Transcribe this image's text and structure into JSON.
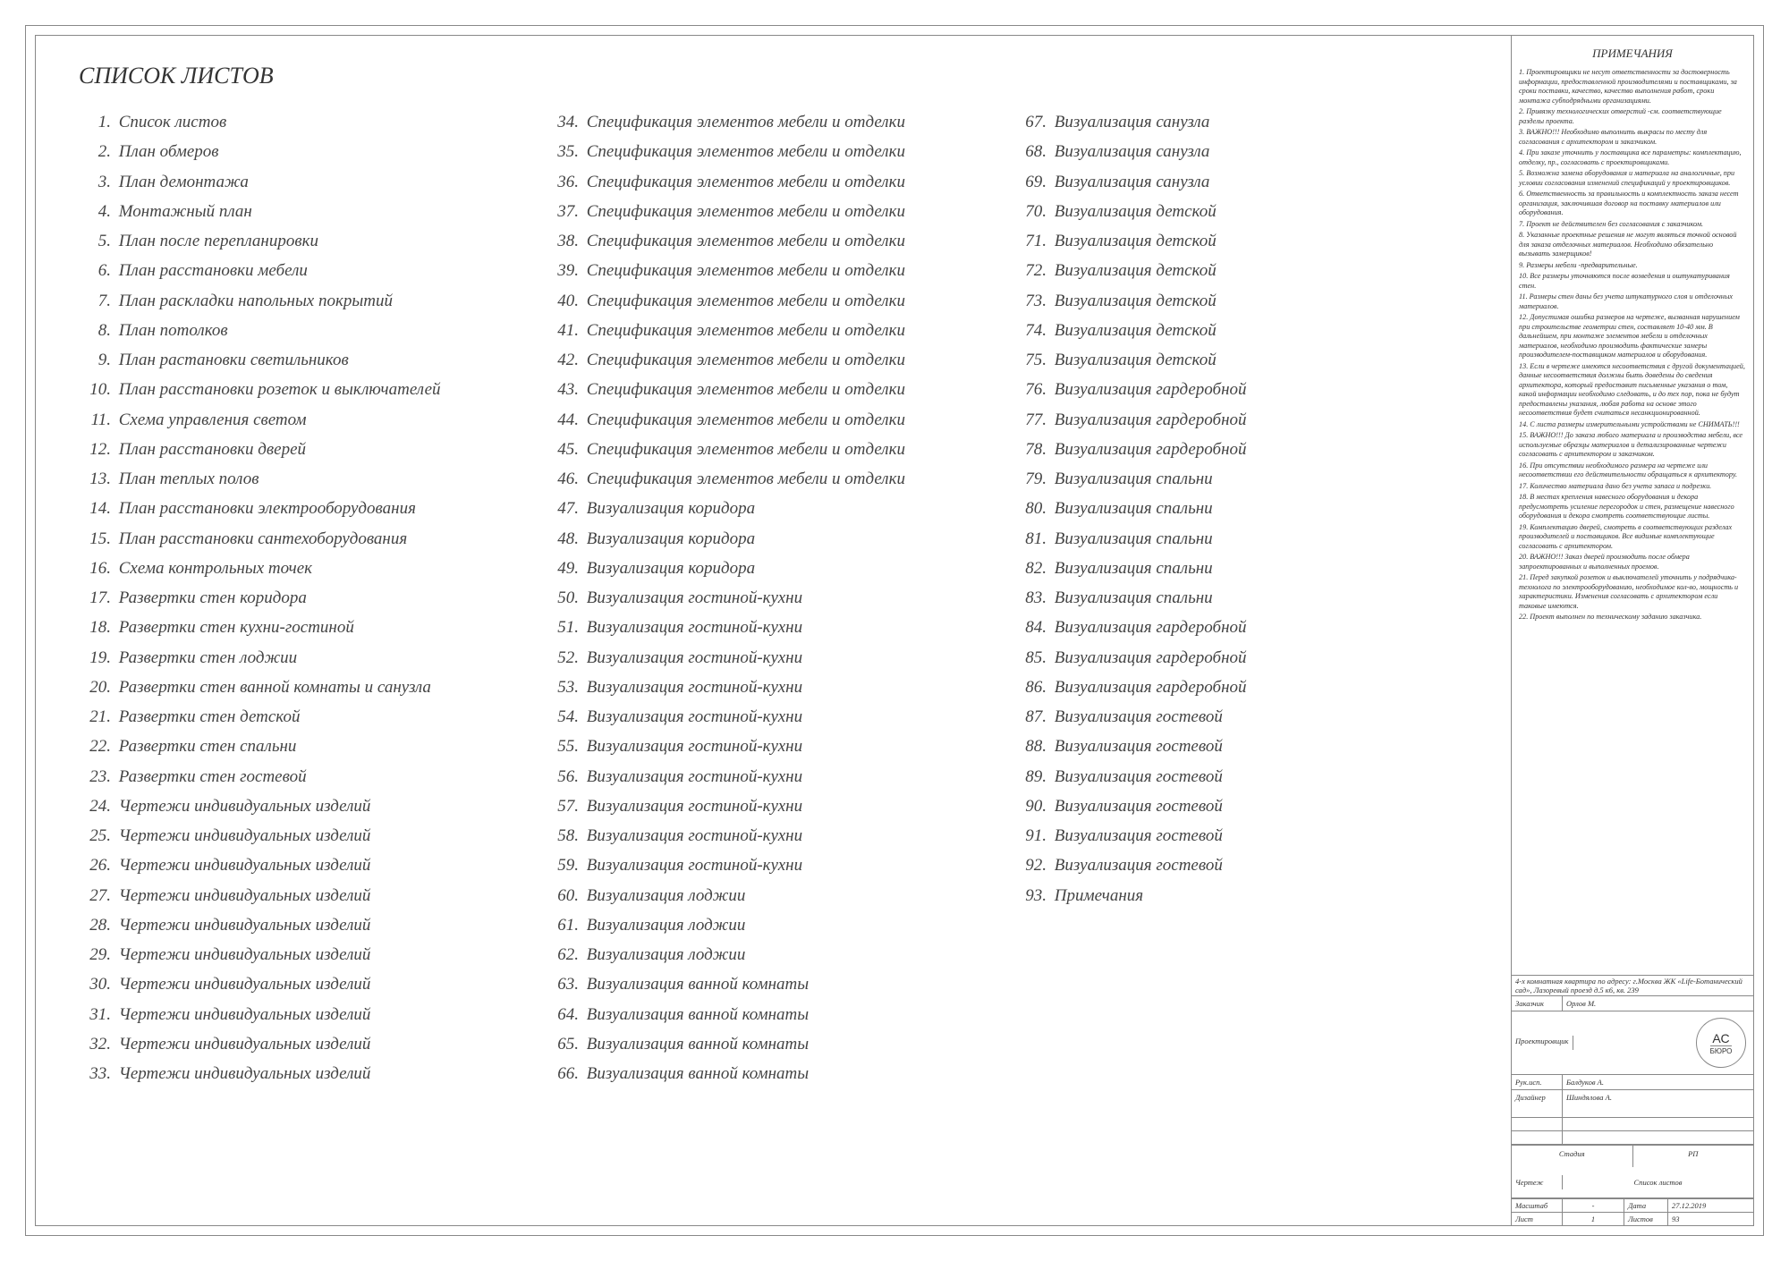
{
  "header": {
    "title": "СПИСОК ЛИСТОВ"
  },
  "sheets": {
    "col1": [
      "Список листов",
      "План обмеров",
      "План демонтажа",
      "Монтажный план",
      "План после перепланировки",
      "План расстановки мебели",
      "План раскладки напольных покрытий",
      "План потолков",
      "План растановки светильников",
      "План расстановки розеток и выключателей",
      "Схема управления светом",
      "План расстановки дверей",
      "План теплых полов",
      "План расстановки электрооборудования",
      "План расстановки сантехоборудования",
      "Схема контрольных точек",
      "Развертки стен коридора",
      "Развертки стен кухни-гостиной",
      "Развертки стен лоджии",
      "Развертки стен ванной комнаты и санузла",
      "Развертки стен детской",
      "Развертки стен спальни",
      "Развертки стен гостевой",
      "Чертежи индивидуальных изделий",
      "Чертежи индивидуальных изделий",
      "Чертежи индивидуальных изделий",
      "Чертежи индивидуальных изделий",
      "Чертежи индивидуальных изделий",
      "Чертежи индивидуальных изделий",
      "Чертежи индивидуальных изделий",
      "Чертежи индивидуальных изделий",
      "Чертежи индивидуальных изделий",
      "Чертежи индивидуальных изделий"
    ],
    "col2": [
      "Спецификация элементов мебели и отделки",
      "Спецификация элементов мебели и отделки",
      "Спецификация элементов мебели и отделки",
      "Спецификация элементов мебели и отделки",
      "Спецификация элементов мебели и отделки",
      "Спецификация элементов мебели и отделки",
      "Спецификация элементов мебели и отделки",
      "Спецификация элементов мебели и отделки",
      "Спецификация элементов мебели и отделки",
      "Спецификация элементов мебели и отделки",
      "Спецификация элементов мебели и отделки",
      "Спецификация элементов мебели и отделки",
      "Спецификация элементов мебели и отделки",
      "Визуализация коридора",
      "Визуализация коридора",
      "Визуализация коридора",
      "Визуализация гостиной-кухни",
      "Визуализация гостиной-кухни",
      "Визуализация гостиной-кухни",
      "Визуализация гостиной-кухни",
      "Визуализация гостиной-кухни",
      "Визуализация гостиной-кухни",
      "Визуализация гостиной-кухни",
      "Визуализация гостиной-кухни",
      "Визуализация гостиной-кухни",
      "Визуализация гостиной-кухни",
      "Визуализация лоджии",
      "Визуализация лоджии",
      "Визуализация лоджии",
      "Визуализация ванной комнаты",
      "Визуализация ванной комнаты",
      "Визуализация ванной комнаты",
      "Визуализация ванной комнаты"
    ],
    "col3": [
      "Визуализация санузла",
      "Визуализация санузла",
      "Визуализация санузла",
      "Визуализация детской",
      "Визуализация детской",
      "Визуализация детской",
      "Визуализация детской",
      "Визуализация детской",
      "Визуализация детской",
      "Визуализация гардеробной",
      "Визуализация гардеробной",
      "Визуализация гардеробной",
      "Визуализация спальни",
      "Визуализация спальни",
      "Визуализация спальни",
      "Визуализация спальни",
      "Визуализация спальни",
      "Визуализация гардеробной",
      "Визуализация гардеробной",
      "Визуализация гардеробной",
      "Визуализация гостевой",
      "Визуализация гостевой",
      "Визуализация гостевой",
      "Визуализация гостевой",
      "Визуализация гостевой",
      "Визуализация гостевой",
      "Примечания"
    ],
    "start": {
      "col1": 1,
      "col2": 34,
      "col3": 67
    }
  },
  "notes": {
    "title": "ПРИМЕЧАНИЯ",
    "items": [
      "1. Проектировщики не несут ответственности за достоверность информации, предоставленной производителями и поставщиками, за сроки поставки, качество, качество выполнения работ, сроки монтажа субподрядными организациями.",
      "2. Привязку технологических отверстий -см. соответствующие разделы проекта.",
      "3. ВАЖНО!!! Необходимо выполнить выкрасы по месту для согласования с архитектором и заказчиком.",
      "4. При заказе уточнить у поставщика все параметры: комплектацию, отделку, пр., согласовать с проектировщиками.",
      "5. Возможна замена оборудования и материала на аналогичные, при условии согласования изменений спецификаций у проектировщиков.",
      "6. Ответственность за правильность и комплектность заказа несет организация, заключившая договор на поставку материалов или оборудования.",
      "7. Проект не действителен без согласования с заказчиком.",
      "8. Указанные проектные решения не могут являться точной основой для заказа отделочных материалов. Необходимо обязательно вызывать замерщиков!",
      "9. Размеры мебели -предварительные.",
      "10. Все размеры уточняются после возведения и оштукатуривания стен.",
      "11. Размеры стен даны без учета штукатурного слоя и отделочных материалов.",
      "12. Допустимая ошибка размеров на чертеже, вызванная нарушением при строительстве геометрии стен, составляет 10-40 мм. В дальнейшем, при монтаже элементов мебели и отделочных материалов, необходимо производить фактические замеры производителем-поставщиком материалов и оборудования.",
      "13. Если в чертеже имеются несоответствия с другой документацией, данные несоответствия должны быть доведены до сведения архитектора, который предоставит письменные указания о том, какой информации необходимо следовать, и до тех пор, пока не будут предоставлены указания, любая работа на основе этого несоответствия будет считаться несанкционированной.",
      "14. С листа размеры измерительными устройствами не СНИМАТЬ!!!",
      "15. ВАЖНО!!! До заказа любого материала и производства мебели, все используемые образцы материалов и детализированные чертежи согласовать с архитектором и заказчиком.",
      "16. При отсутствии необходимого размера на чертеже или несоответствии его действительности обращаться к архитектору.",
      "17. Количество материала дано без учета запаса и подрезки.",
      "18. В местах крепления навесного оборудования и декора предусмотреть усиление перегородок и стен, размещение навесного оборудования и декора смотреть соответствующие листы.",
      "19. Комплектацию дверей, смотреть в соответствующих разделах производителей и поставщиков. Все видимые комплектующие согласовать с архитектором.",
      "20. ВАЖНО!!! Заказ дверей производить после обмера запроектированных и выполненных проемов.",
      "21. Перед закупкой розеток и выключателей уточнить у подрядчика-технолога по электрооборудованию, необходимое кол-во, мощность и характеристики. Изменения согласовать с архитектором если таковые имеются.",
      "22. Проект выполнен по техническому заданию заказчика."
    ]
  },
  "titleblock": {
    "project": "4-х комнатная квартира по адресу: г.Москва ЖК «Life-Ботанический сад», Лазоревый проезд д.5 к6, кв. 239",
    "client_label": "Заказчик",
    "client": "Орлов М.",
    "designer_label": "Проектировщик",
    "logo_top": "АС",
    "logo_bottom": "БЮРО",
    "roles": [
      {
        "label": "Рук.исп.",
        "name": "Балдуков А."
      },
      {
        "label": "Дизайнер",
        "name": "Шиндялова А."
      }
    ],
    "stage_label": "Стадия",
    "stage": "РП",
    "sheet_title_label": "Чертеж",
    "sheet_title": "Список листов",
    "scale_label": "Масштаб",
    "scale": "-",
    "date_label": "Дата",
    "date": "27.12.2019",
    "sheet_no_label": "Лист",
    "sheet_no": "1",
    "sheets_total_label": "Листов",
    "sheets_total": "93"
  }
}
